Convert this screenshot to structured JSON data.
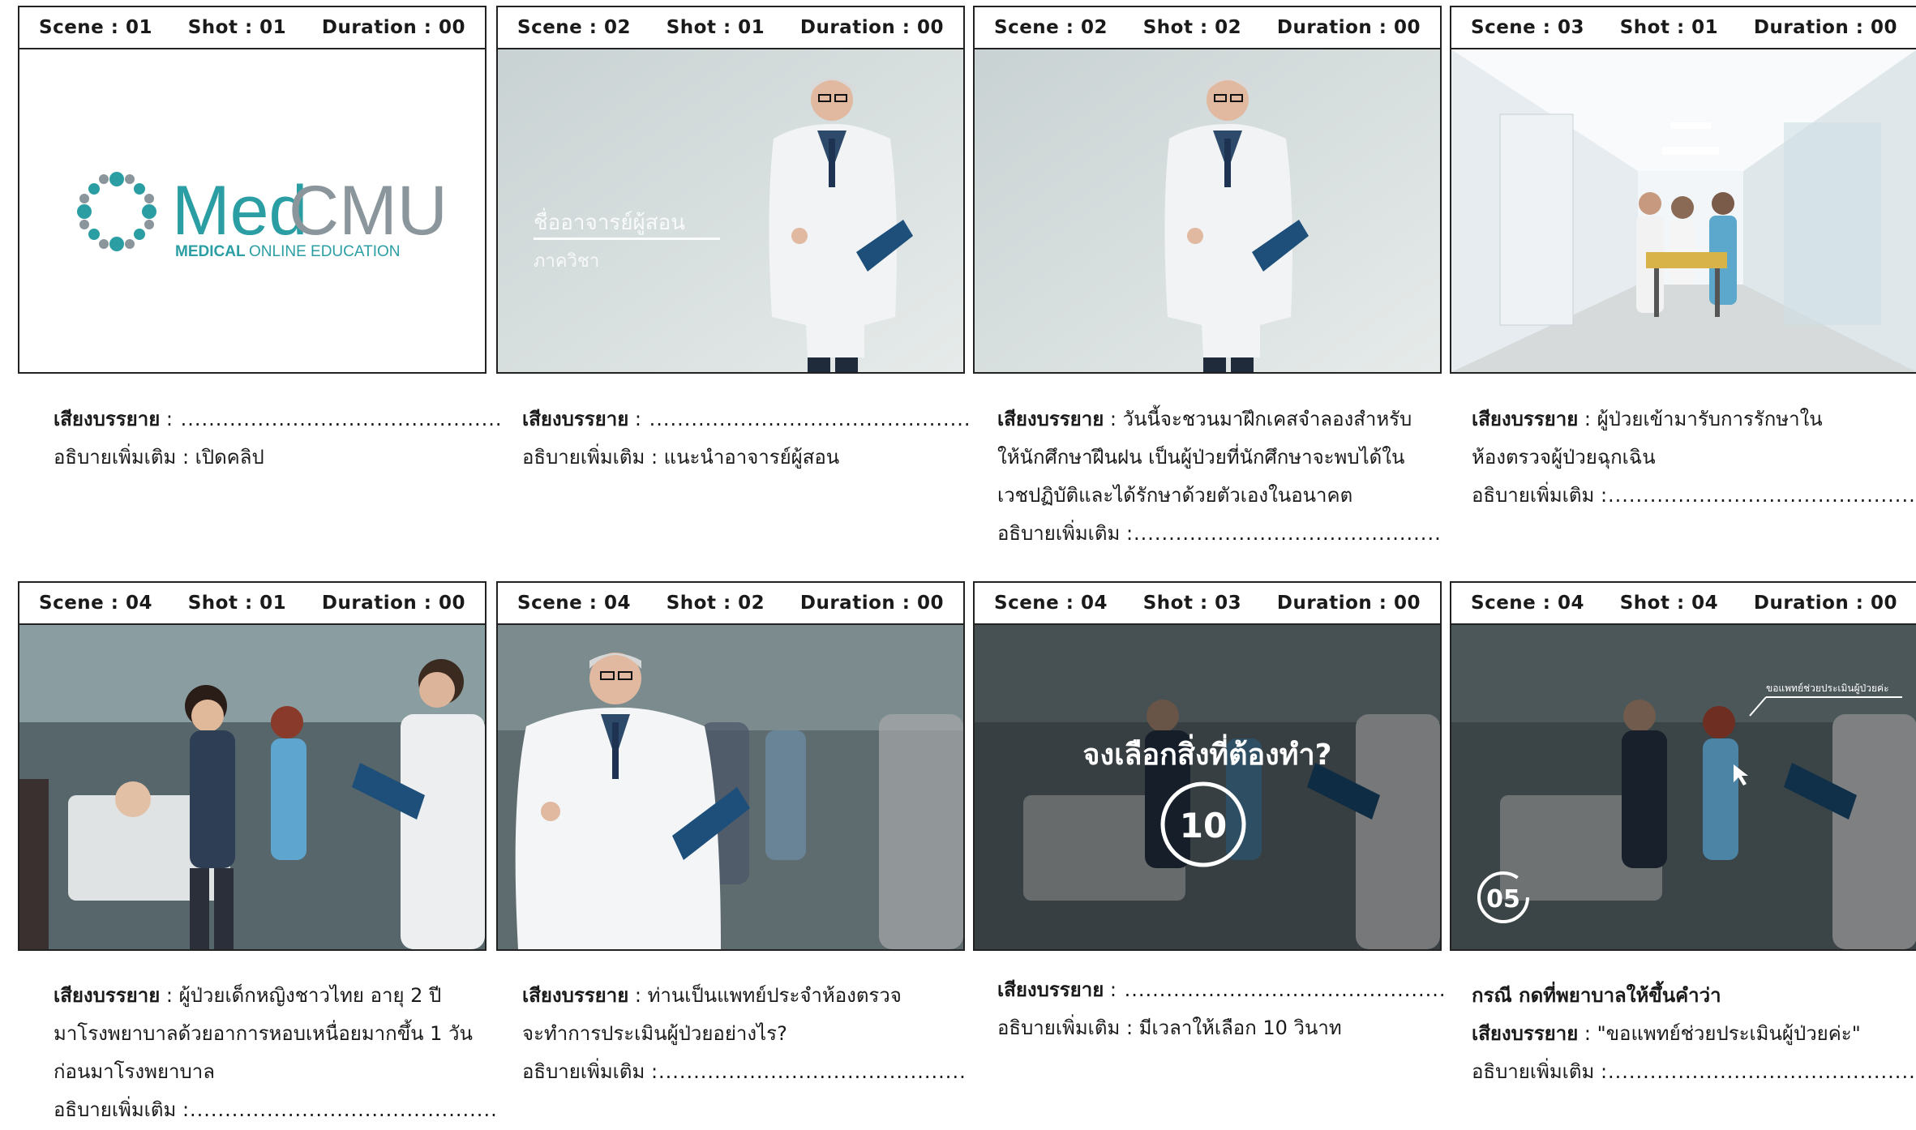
{
  "labels": {
    "scene": "Scene : ",
    "shot": "Shot : ",
    "duration": "Duration : ",
    "narration": "เสียงบรรยาย",
    "extra": "อธิบายเพิ่มเติม",
    "case": "กรณี กดที่พยาบาลให้ขึ้นคำว่า",
    "blank": "............................................."
  },
  "panels": [
    {
      "scene": "01",
      "shot": "01",
      "duration": "00"
    },
    {
      "scene": "02",
      "shot": "01",
      "duration": "00"
    },
    {
      "scene": "02",
      "shot": "02",
      "duration": "00"
    },
    {
      "scene": "03",
      "shot": "01",
      "duration": "00"
    },
    {
      "scene": "04",
      "shot": "01",
      "duration": "00"
    },
    {
      "scene": "04",
      "shot": "02",
      "duration": "00"
    },
    {
      "scene": "04",
      "shot": "03",
      "duration": "00"
    },
    {
      "scene": "04",
      "shot": "04",
      "duration": "00"
    }
  ],
  "logo": {
    "brand_med": "Med",
    "brand_cmu": "CMU",
    "tagline_a": "MEDICAL",
    "tagline_b": " ONLINE EDUCATION",
    "teal": "#2a9ea3",
    "gray": "#8a959c"
  },
  "lower_third": {
    "name": "ชื่ออาจารย์ผู้สอน",
    "dept": "ภาควิชา"
  },
  "overlay": {
    "question": "จงเลือกสิ่งที่ต้องทำ?",
    "timer_10": "10",
    "timer_05": "05",
    "nurse_label": "ขอแพทย์ช่วยประเมินผู้ป่วยค่ะ"
  },
  "descriptions": {
    "p1": {
      "narration": ": ..............................................",
      "extra": ":   เปิดคลิป"
    },
    "p2": {
      "narration": ": ..............................................",
      "extra": ": แนะนำอาจารย์ผู้สอน"
    },
    "p3": {
      "narration": ": วันนี้จะชวนมาฝึกเคสจำลองสำหรับ",
      "narration2": "ให้นักศึกษาฝึนฝน เป็นผู้ป่วยที่นักศึกษาจะพบได้ใน",
      "narration3": "เวชปฏิบัติและได้รักษาด้วยตัวเองในอนาคต",
      "extra": ":............................................"
    },
    "p4": {
      "narration": ": ผู้ป่วยเข้ามารับการรักษาใน",
      "narration2": "ห้องตรวจผู้ป่วยฉุกเฉิน",
      "extra": ":............................................"
    },
    "p5": {
      "narration": ": ผู้ป่วยเด็กหญิงชาวไทย อายุ 2 ปี",
      "narration2": "มาโรงพยาบาลด้วยอาการหอบเหนื่อยมากขึ้น 1 วัน",
      "narration3": "ก่อนมาโรงพยาบาล",
      "extra": ":............................................"
    },
    "p6": {
      "narration": ": ท่านเป็นแพทย์ประจำห้องตรวจ",
      "narration2": "จะทำการประเมินผู้ป่วยอย่างไร?",
      "extra": ":............................................"
    },
    "p7": {
      "narration": ": ..............................................",
      "extra": ": มีเวลาให้เลือก 10 วินาท"
    },
    "p8": {
      "narration": ": \"ขอแพทย์ช่วยประเมินผู้ป่วยค่ะ\"",
      "extra": ":............................................"
    }
  }
}
